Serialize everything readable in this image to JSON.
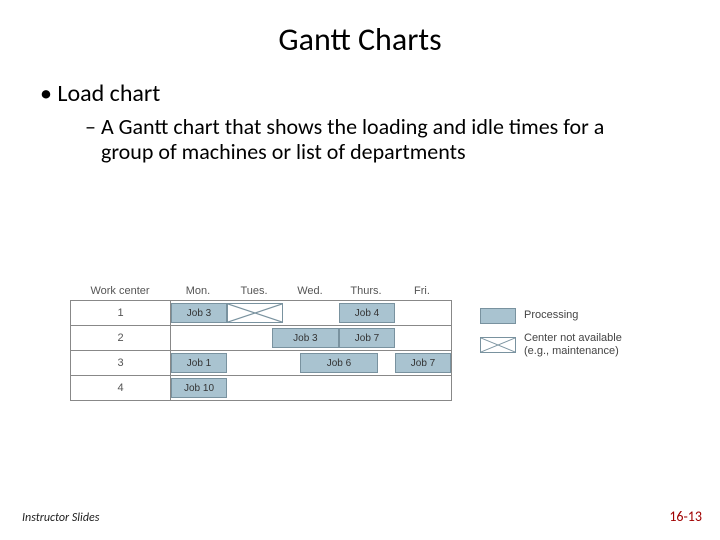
{
  "title": "Gantt Charts",
  "bullet1": "Load chart",
  "bullet2": "A Gantt chart that shows the loading and idle times for a group of machines or list of departments",
  "footer_left": "Instructor Slides",
  "footer_right": "16-13",
  "legend": {
    "processing": "Processing",
    "unavail_l1": "Center not available",
    "unavail_l2": "(e.g., maintenance)"
  },
  "chart_data": {
    "type": "table",
    "title": "Load chart",
    "col_header_label": "Work center",
    "day_labels": [
      "Mon.",
      "Tues.",
      "Wed.",
      "Thurs.",
      "Fri."
    ],
    "day_width": 56,
    "rows": [
      {
        "center": "1",
        "bars": [
          {
            "label": "Job 3",
            "start": 0.0,
            "span": 1.0
          },
          {
            "label": "Job 4",
            "start": 3.0,
            "span": 1.0
          }
        ],
        "unavailable": [
          {
            "start": 1.0,
            "span": 1.0
          }
        ]
      },
      {
        "center": "2",
        "bars": [
          {
            "label": "Job 3",
            "start": 1.8,
            "span": 1.2
          },
          {
            "label": "Job 7",
            "start": 3.0,
            "span": 1.0
          }
        ],
        "unavailable": []
      },
      {
        "center": "3",
        "bars": [
          {
            "label": "Job 1",
            "start": 0.0,
            "span": 1.0
          },
          {
            "label": "Job 6",
            "start": 2.3,
            "span": 1.4
          },
          {
            "label": "Job 7",
            "start": 4.0,
            "span": 1.0
          }
        ],
        "unavailable": []
      },
      {
        "center": "4",
        "bars": [
          {
            "label": "Job 10",
            "start": 0.0,
            "span": 1.0
          }
        ],
        "unavailable": []
      }
    ]
  }
}
